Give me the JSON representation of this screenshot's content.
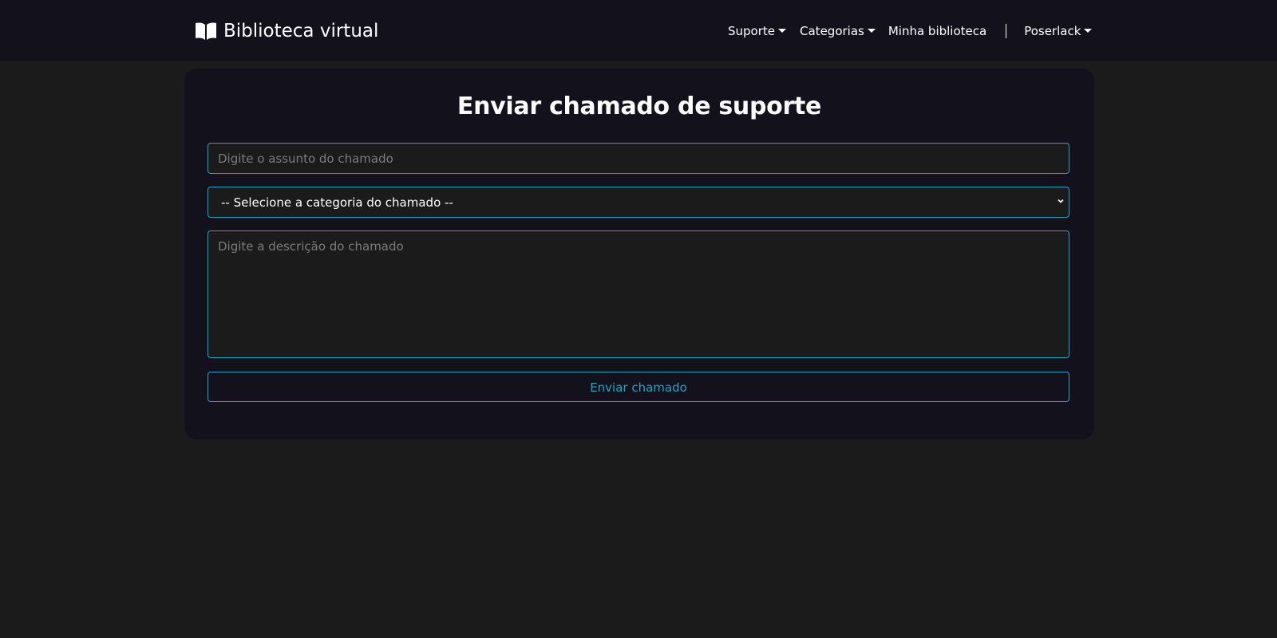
{
  "navbar": {
    "brand_icon": "open-book-icon",
    "brand_label": "Biblioteca virtual",
    "items": [
      {
        "label": "Suporte",
        "dropdown": true
      },
      {
        "label": "Categorias",
        "dropdown": true
      },
      {
        "label": "Minha biblioteca",
        "dropdown": false
      }
    ],
    "user": {
      "label": "Poserlack",
      "dropdown": true
    }
  },
  "form": {
    "title": "Enviar chamado de suporte",
    "subject_placeholder": "Digite o assunto do chamado",
    "subject_value": "",
    "category_selected": "-- Selecione a categoria do chamado --",
    "description_placeholder": "Digite a descrição do chamado",
    "description_value": "",
    "submit_label": "Enviar chamado"
  },
  "colors": {
    "background": "#1b1b1b",
    "surface": "#12111c",
    "accent": "#1fa4c4",
    "text": "#ffffff",
    "placeholder": "#7b7b7b"
  }
}
